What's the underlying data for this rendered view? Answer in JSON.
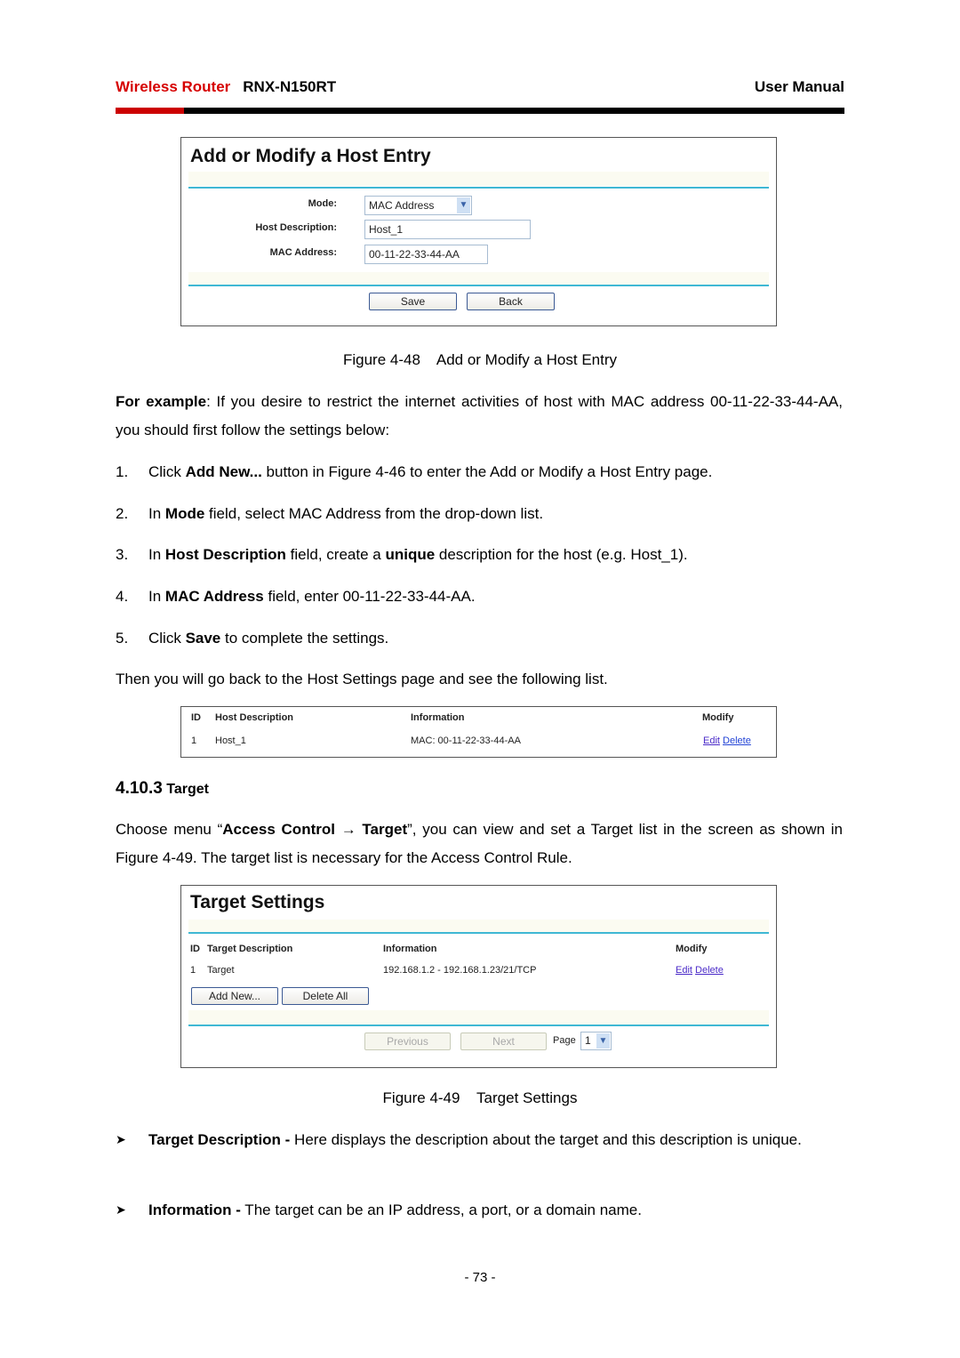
{
  "header": {
    "brand": "Wireless Router",
    "model": "RNX-N150RT",
    "doc_type": "User Manual",
    "brand_color": "#cc0000"
  },
  "figure48": {
    "title": "Add or Modify a Host Entry",
    "fields": {
      "mode_label": "Mode:",
      "mode_value": "MAC Address",
      "host_desc_label": "Host Description:",
      "host_desc_value": "Host_1",
      "mac_label": "MAC Address:",
      "mac_value": "00-11-22-33-44-AA"
    },
    "buttons": {
      "save": "Save",
      "back": "Back"
    },
    "caption": "Figure 4-48    Add or Modify a Host Entry"
  },
  "intro": {
    "lead_bold": "For example",
    "lead_rest": ": If you desire to restrict the internet activities of host with MAC address 00-11-22-33-44-AA, you should first follow the settings below:"
  },
  "steps": [
    {
      "num": "1.",
      "parts": [
        "Click ",
        "Add New...",
        " button in Figure 4-46 to enter the Add or Modify a Host Entry page."
      ]
    },
    {
      "num": "2.",
      "parts": [
        "In ",
        "Mode",
        " field, select MAC Address from the drop-down list."
      ]
    },
    {
      "num": "3.",
      "parts": [
        "In ",
        "Host Description",
        " field, create a ",
        "unique",
        " description for the host (e.g. Host_1)."
      ]
    },
    {
      "num": "4.",
      "parts": [
        "In ",
        "MAC Address",
        " field, enter 00-11-22-33-44-AA."
      ]
    },
    {
      "num": "5.",
      "parts": [
        "Click ",
        "Save",
        " to complete the settings."
      ]
    }
  ],
  "then_text": "Then you will go back to the Host Settings page and see the following list.",
  "host_list": {
    "headers": [
      "ID",
      "Host Description",
      "Information",
      "Modify"
    ],
    "rows": [
      {
        "id": "1",
        "desc": "Host_1",
        "info": "MAC: 00-11-22-33-44-AA",
        "edit": "Edit",
        "delete": "Delete"
      }
    ]
  },
  "section": {
    "number": "4.10.3",
    "title": "Target"
  },
  "section_para": {
    "pre": "Choose menu “",
    "bold": "Access Control → Target",
    "post": "”, you can view and set a Target list in the screen as shown in Figure 4-49. The target list is necessary for the Access Control Rule."
  },
  "figure49": {
    "title": "Target Settings",
    "headers": [
      "ID",
      "Target Description",
      "Information",
      "Modify"
    ],
    "rows": [
      {
        "id": "1",
        "desc": "Target",
        "info": "192.168.1.2 - 192.168.1.23/21/TCP",
        "edit": "Edit",
        "delete": "Delete"
      }
    ],
    "buttons": {
      "add_new": "Add New...",
      "delete_all": "Delete All",
      "previous": "Previous",
      "next": "Next"
    },
    "page_label": "Page",
    "page_value": "1",
    "caption": "Figure 4-49    Target Settings"
  },
  "bullets": [
    {
      "bold": "Target Description -",
      "rest": " Here displays the description about the target and this description is unique."
    },
    {
      "bold": "Information -",
      "rest": " The target can be an IP address, a port, or a domain name."
    }
  ],
  "page_number": "- 73 -"
}
